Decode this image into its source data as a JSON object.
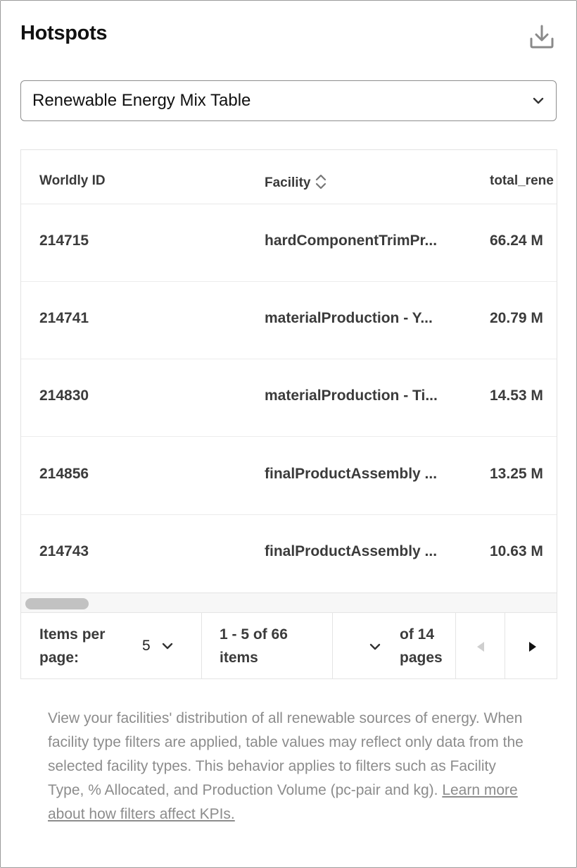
{
  "panel": {
    "title": "Hotspots",
    "download_icon": "download-icon"
  },
  "select": {
    "value": "Renewable Energy Mix Table",
    "icon": "chevron-down-icon"
  },
  "table": {
    "columns": [
      {
        "label": "Worldly ID"
      },
      {
        "label": "Facility",
        "sort_icon": "sort-icon"
      },
      {
        "label": "total_rene"
      }
    ],
    "rows": [
      {
        "id": "214715",
        "facility": "hardComponentTrimPr...",
        "total": "66.24 M"
      },
      {
        "id": "214741",
        "facility": "materialProduction - Y...",
        "total": "20.79 M"
      },
      {
        "id": "214830",
        "facility": "materialProduction - Ti...",
        "total": "14.53 M"
      },
      {
        "id": "214856",
        "facility": "finalProductAssembly ...",
        "total": "13.25 M"
      },
      {
        "id": "214743",
        "facility": "finalProductAssembly ...",
        "total": "10.63 M"
      }
    ]
  },
  "pagination": {
    "items_per_page_label_1": "Items per",
    "items_per_page_label_2": "page:",
    "items_per_page_value": "5",
    "range_line_1": "1 - 5 of 66",
    "range_line_2": "items",
    "pages_line_1": "of 14",
    "pages_line_2": "pages",
    "prev_icon": "caret-left-icon",
    "next_icon": "caret-right-icon"
  },
  "help": {
    "text": "View your facilities' distribution of all renewable sources of energy. When facility type filters are applied, table values may reflect only data from the selected facility types. This behavior applies to filters such as Facility Type, % Allocated, and Production Volume (pc-pair and kg). ",
    "link": "Learn more about how filters affect KPIs."
  }
}
